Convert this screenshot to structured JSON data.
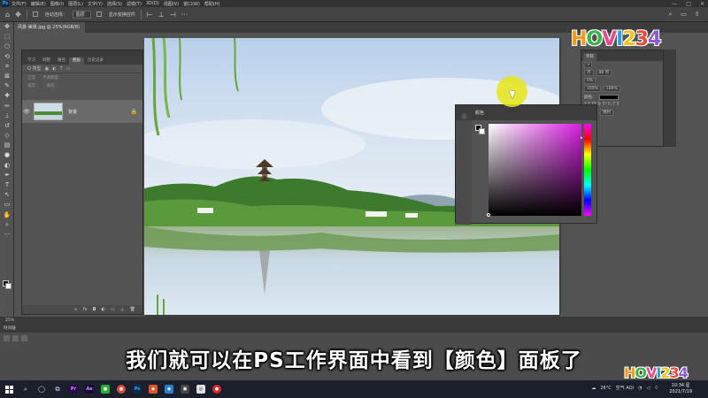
{
  "menubar": {
    "logo": "Ps",
    "items": [
      "文件(F)",
      "编辑(E)",
      "图像(I)",
      "图层(L)",
      "文字(Y)",
      "选择(S)",
      "滤镜(T)",
      "3D(D)",
      "视图(V)",
      "窗口(W)",
      "帮助(H)"
    ],
    "window_controls": [
      "—",
      "□",
      "✕"
    ]
  },
  "optbar": {
    "auto_select_label": "自动选择：",
    "auto_select_value": "图层",
    "show_transform_label": "显示变换控件"
  },
  "document": {
    "tab_title": "风景-美景.jpg @ 25%(RGB/8)"
  },
  "layers_panel": {
    "tabs": [
      "学习",
      "调整",
      "路径",
      "图层",
      "历史记录"
    ],
    "active_tab": "图层",
    "filter_label": "Q 类型",
    "blend_mode": "正常",
    "opacity_label": "不透明度：",
    "fill_label": "填充：",
    "lock_label": "锁定：",
    "layer_name": "背景"
  },
  "color_panel": {
    "tab_label": "颜色",
    "hue_color": "#d81ee1"
  },
  "props_panel": {
    "tab_label": "字符",
    "rows": [
      "∨",
      "点",
      "80 点",
      "0%",
      "100%",
      "100%",
      "颜色：",
      "中文",
      "锐利"
    ]
  },
  "status": {
    "zoom": "25%",
    "timeline_label": "时间轴"
  },
  "subtitle": "我们就可以在PS工作界面中看到【颜色】面板了",
  "watermark": {
    "text": "HOVI234"
  },
  "taskbar": {
    "weather": "26°C",
    "tray_text": "空气 AQI",
    "clock_time": "10:34 星",
    "clock_date": "2021/7/19"
  }
}
